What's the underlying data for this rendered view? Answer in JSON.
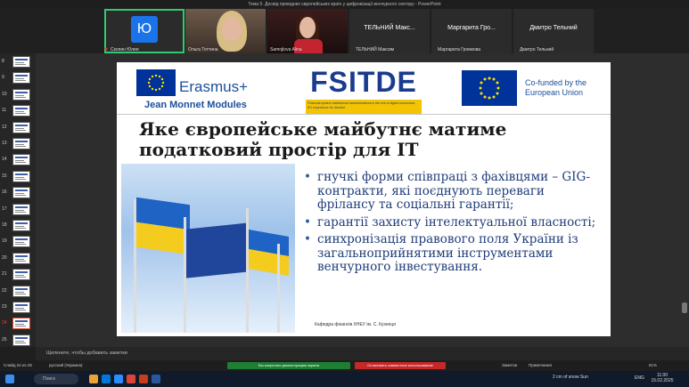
{
  "window": {
    "title": "Тема 5. Досвід провідних європейських країн у цифровізації венчурного сектору - PowerPoint"
  },
  "video": {
    "tiles": [
      {
        "label": "Скопин Юлия",
        "initial": "Ю"
      },
      {
        "label": "Ольга Тоттина"
      },
      {
        "label": "Samojlova Alina"
      },
      {
        "label": "ТЕЛЬНИЙ Максим",
        "big": "ТЕЛЬНИЙ Макс..."
      },
      {
        "label": "Маргарита Громкова",
        "big": "Маргарита Гро..."
      },
      {
        "label": "Дмитро Тельний",
        "big": "Дмитро Тельний"
      }
    ]
  },
  "thumbnails": [
    {
      "num": "8"
    },
    {
      "num": "9"
    },
    {
      "num": "10"
    },
    {
      "num": "11"
    },
    {
      "num": "12"
    },
    {
      "num": "13"
    },
    {
      "num": "14"
    },
    {
      "num": "15"
    },
    {
      "num": "16"
    },
    {
      "num": "17"
    },
    {
      "num": "18"
    },
    {
      "num": "19"
    },
    {
      "num": "20"
    },
    {
      "num": "21"
    },
    {
      "num": "22"
    },
    {
      "num": "23"
    },
    {
      "num": "24"
    },
    {
      "num": "25"
    }
  ],
  "selected_thumbnail": "24",
  "slide": {
    "erasmus": "Erasmus+",
    "jean_monnet": "Jean Monnet Modules",
    "fsitde": "FSITDE",
    "fsitde_sub": "Financial system institutional transformations in the era of digital economics: EU experience for Ukraine",
    "cofunded": "Co-funded by the European Union",
    "title": "Яке європейське майбутнє матиме податковий простір для IT",
    "bullets": [
      "гнучкі форми співпраці з фахівцями – GIG-контракти, які поєднують переваги фрілансу та соціальні гарантії;",
      "гарантії захисту інтелектуальної власності;",
      "синхронізація правового поля України із загальноприйнятими інструментами венчурного інвестування."
    ],
    "footer": "Кафедра фінансів ХНЕУ ім. С. Кузнеця"
  },
  "notes": {
    "placeholder": "Щелкните, чтобы добавить заметки"
  },
  "status": {
    "slide": "Слайд 24 из 25",
    "language": "русский (Украина)",
    "share_green": "Вы запустили демонстрацию экрана",
    "share_red": "Остановить совместное использование",
    "notes": "Заметки",
    "comments": "Примечания",
    "zoom": "51%"
  },
  "taskbar": {
    "search": "Поиск",
    "weather": "2 cm of snow  Sun",
    "lang": "ENG",
    "time": "11:00",
    "date": "15.02.2025"
  },
  "colors": {
    "accent_green": "#2ecc71",
    "selected_red": "#e04a2f",
    "title_blue": "#1a3b8f"
  }
}
